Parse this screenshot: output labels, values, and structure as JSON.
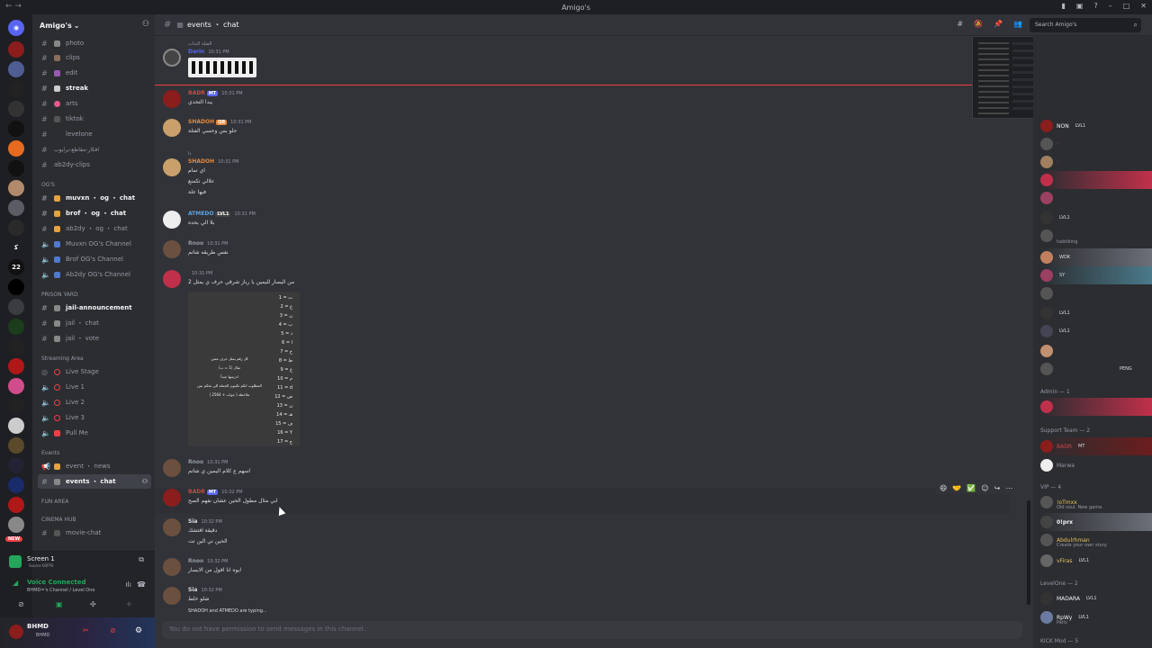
{
  "window": {
    "title": "Amigo's"
  },
  "server": {
    "name": "Amigo's",
    "folder_badge": "22",
    "new_badge": "NEW"
  },
  "channels": [
    {
      "label": "photo"
    },
    {
      "label": "clips"
    },
    {
      "label": "edit"
    },
    {
      "label": "streak"
    },
    {
      "label": "arts"
    },
    {
      "label": "tiktok"
    },
    {
      "label": "levelone"
    },
    {
      "label": "افكار-مقاطع-برايوب"
    },
    {
      "label": "ab2dy-clips"
    }
  ],
  "categories": {
    "ogs": "OG'S",
    "prison": "PRISON YARD",
    "streaming": "Streaming Area",
    "events": "Events",
    "fun": "FUN AREA",
    "cinema": "CINEMA HUB"
  },
  "og_channels": [
    {
      "label": "muvxn ・ og ・ chat"
    },
    {
      "label": "brof ・ og ・ chat"
    },
    {
      "label": "ab2dy ・ og ・ chat"
    },
    {
      "label": "Muvxn OG's Channel"
    },
    {
      "label": "Brof OG's Channel"
    },
    {
      "label": "Ab2dy OG's Channel"
    }
  ],
  "prison_channels": [
    {
      "label": "jail-announcement"
    },
    {
      "label": "jail ・ chat"
    },
    {
      "label": "jail ・ vote"
    }
  ],
  "streaming_channels": [
    {
      "label": "Live Stage"
    },
    {
      "label": "Live 1"
    },
    {
      "label": "Live 2"
    },
    {
      "label": "Live 3"
    },
    {
      "label": "Pull Me"
    }
  ],
  "events_channels": [
    {
      "label": "event ・ news"
    },
    {
      "label": "events ・ chat"
    }
  ],
  "cinema_channels": [
    {
      "label": "movie-chat"
    }
  ],
  "voice": {
    "screen_label": "Screen 1",
    "screen_sub": "Source 60FPS",
    "status": "Voice Connected",
    "channel": "BHMD=‏'s Channel / Level One"
  },
  "user": {
    "name": "BHMD",
    "tag": "BHMD"
  },
  "topbar": {
    "channel": "events ・ chat",
    "search_placeholder": "Search Amigo's"
  },
  "messages": [
    {
      "author": "Darin",
      "time": "10:31 PM",
      "text": "",
      "reply": "الضلة البدات"
    },
    {
      "author": "BADR",
      "time": "10:31 PM",
      "text": "يبدا التحدي",
      "badge": "MT"
    },
    {
      "author": "SHADOH",
      "time": "10:31 PM",
      "text": "حلو بس وحسي الفتلة",
      "badge": "QB"
    },
    {
      "author": "SHADOH",
      "time": "10:31 PM",
      "text": "اي تمام",
      "text2": "علالي تكمنع",
      "text3": "فيها علة",
      "reply": "ذا"
    },
    {
      "author": "ATMEDO",
      "time": "10:31 PM",
      "text": "بلا الي بحده",
      "badge": "LVL1"
    },
    {
      "author": "Rnoo",
      "time": "10:31 PM",
      "text": "نفس طريقه شاتم"
    },
    {
      "author": "",
      "time": "10:31 PM",
      "text": "من اليسار لليمين يا رباز شرقي حرف ي يمثل 2"
    },
    {
      "author": "Rnoo",
      "time": "10:31 PM",
      "text": "اسهم ع كلام اليمين ي شاتم"
    },
    {
      "author": "BADR",
      "time": "10:32 PM",
      "text": "ابي مثال مطول الحين عشان نفهم الصح",
      "badge": "MT"
    },
    {
      "author": "Sia",
      "time": "10:32 PM",
      "text": "دقيقة افتشك",
      "text2": "الحين ني الين تت"
    },
    {
      "author": "Rnoo",
      "time": "10:32 PM",
      "text": "ايوه انا اقول من الايسار"
    },
    {
      "author": "Sia",
      "time": "10:32 PM",
      "text": "شلو خلط"
    }
  ],
  "cipher_image": {
    "rows": [
      "1 = ت",
      "2 = ع",
      "3 = ن",
      "4 = ب",
      "5 = د",
      "6 = ا",
      "7 = خ",
      "8 = ط",
      "9 = ع",
      "10 = م",
      "11 = d",
      "12 = ص",
      "13 = ن",
      "14 = هـ",
      "15 = ف",
      "16 = Y",
      "17 = ج"
    ],
    "caption": "كل رقم يمثل حرف معين",
    "caption2": "مثال (1 = ت)",
    "caption3": "ادرسها جيداً",
    "caption4": "المطلوب انكم تكتبون الجملة الي تحكم بس",
    "caption5": "ملاحظة ( جواب + 2564 )"
  },
  "typing": "SHADOH and ATMEDO are typing...",
  "input_placeholder": "You do not have permission to send messages in this channel.",
  "members": {
    "groups": [
      {
        "label": "Admin — 1"
      },
      {
        "label": "Support Team — 2"
      },
      {
        "label": "VIP — 4"
      },
      {
        "label": "LevelOne — 2"
      },
      {
        "label": "KICK Mod — 5"
      }
    ],
    "list": [
      {
        "name": "NON",
        "badge": "LVL1"
      },
      {
        "name": "LVL1"
      },
      {
        "name": "habtiking"
      },
      {
        "name": "WDK"
      },
      {
        "name": "SY"
      },
      {
        "name": "LVL1"
      },
      {
        "name": "LVL1"
      },
      {
        "name": "PENG"
      },
      {
        "name": "BADR",
        "badge": "MT"
      },
      {
        "name": "Marwa"
      },
      {
        "name": "!oTmxx",
        "sub": "Old soul. New game."
      },
      {
        "name": "0!prx"
      },
      {
        "name": "Abdulrhman",
        "sub": "Create your own story."
      },
      {
        "name": "vFiras",
        "badge": "LVL1"
      },
      {
        "name": "MADARA",
        "badge": "LVL1"
      },
      {
        "name": "RpWy",
        "badge": "LVL1",
        "sub": "Paris"
      }
    ]
  },
  "colors": {
    "accent": "#5865f2",
    "danger": "#f23f43",
    "bg": "#313338"
  }
}
